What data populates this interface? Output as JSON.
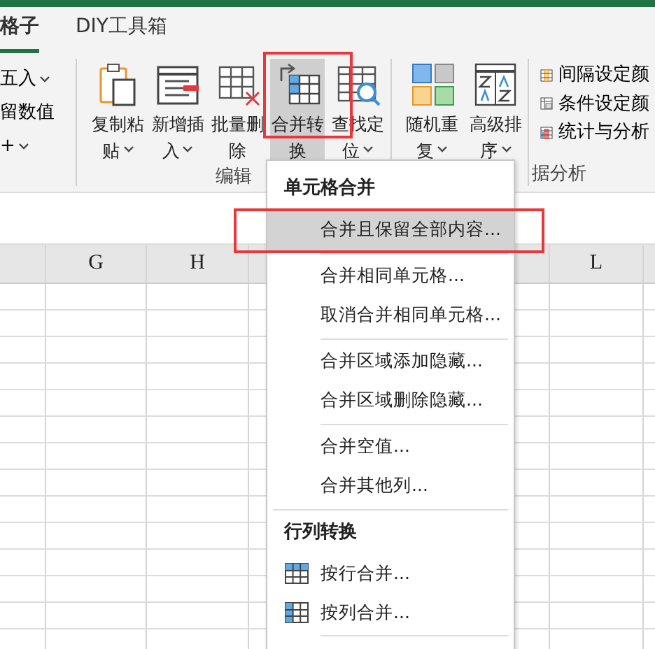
{
  "tabs": [
    {
      "label": "格子",
      "selected": true
    },
    {
      "label": "DIY工具箱",
      "selected": false
    }
  ],
  "ribbon": {
    "left_items": [
      {
        "label": "五入",
        "dropdown": true
      },
      {
        "label": "留数值",
        "dropdown": false
      },
      {
        "label": "+",
        "dropdown": true
      }
    ],
    "edit_buttons": [
      {
        "lines": [
          "复制粘",
          "贴"
        ],
        "dropdown": true,
        "kind": "paste",
        "pressed": false,
        "marked": false
      },
      {
        "lines": [
          "新增插",
          "入"
        ],
        "dropdown": true,
        "kind": "insert",
        "pressed": false,
        "marked": false
      },
      {
        "lines": [
          "批量删",
          "除"
        ],
        "dropdown": false,
        "kind": "delete",
        "pressed": false,
        "marked": false
      },
      {
        "lines": [
          "合并转",
          "换"
        ],
        "dropdown": false,
        "kind": "merge",
        "pressed": true,
        "marked": true
      },
      {
        "lines": [
          "查找定",
          "位"
        ],
        "dropdown": true,
        "kind": "find",
        "pressed": false,
        "marked": false
      }
    ],
    "edit_label": "编辑",
    "data_buttons": [
      {
        "lines": [
          "随机重",
          "复"
        ],
        "dropdown": true,
        "kind": "random"
      },
      {
        "lines": [
          "高级排",
          "序"
        ],
        "dropdown": true,
        "kind": "sort"
      }
    ],
    "small_buttons": [
      {
        "label": "间隔设定颜",
        "kind": "interval"
      },
      {
        "label": "条件设定颜",
        "kind": "condition"
      },
      {
        "label": "统计与分析",
        "kind": "stats"
      }
    ],
    "data_label": "据分析"
  },
  "columns": [
    {
      "label": "G"
    },
    {
      "label": "H"
    },
    {
      "label": "L"
    }
  ],
  "menu": {
    "sections": [
      {
        "header": "单元格合并",
        "groups": [
          [
            {
              "label": "合并且保留全部内容...",
              "selected": true,
              "marked": true
            }
          ],
          [
            {
              "label": "合并相同单元格...",
              "selected": false,
              "marked": false
            },
            {
              "label": "取消合并相同单元格...",
              "selected": false,
              "marked": false
            }
          ],
          [
            {
              "label": "合并区域添加隐藏...",
              "selected": false,
              "marked": false
            },
            {
              "label": "合并区域删除隐藏...",
              "selected": false,
              "marked": false
            }
          ],
          [
            {
              "label": "合并空值...",
              "selected": false,
              "marked": false
            },
            {
              "label": "合并其他列...",
              "selected": false,
              "marked": false
            }
          ]
        ]
      },
      {
        "header": "行列转换",
        "groups": [
          [
            {
              "label": "按行合并...",
              "selected": false,
              "marked": false,
              "kind": "rows"
            },
            {
              "label": "按列合并...",
              "selected": false,
              "marked": false,
              "kind": "cols"
            }
          ]
        ]
      }
    ]
  }
}
